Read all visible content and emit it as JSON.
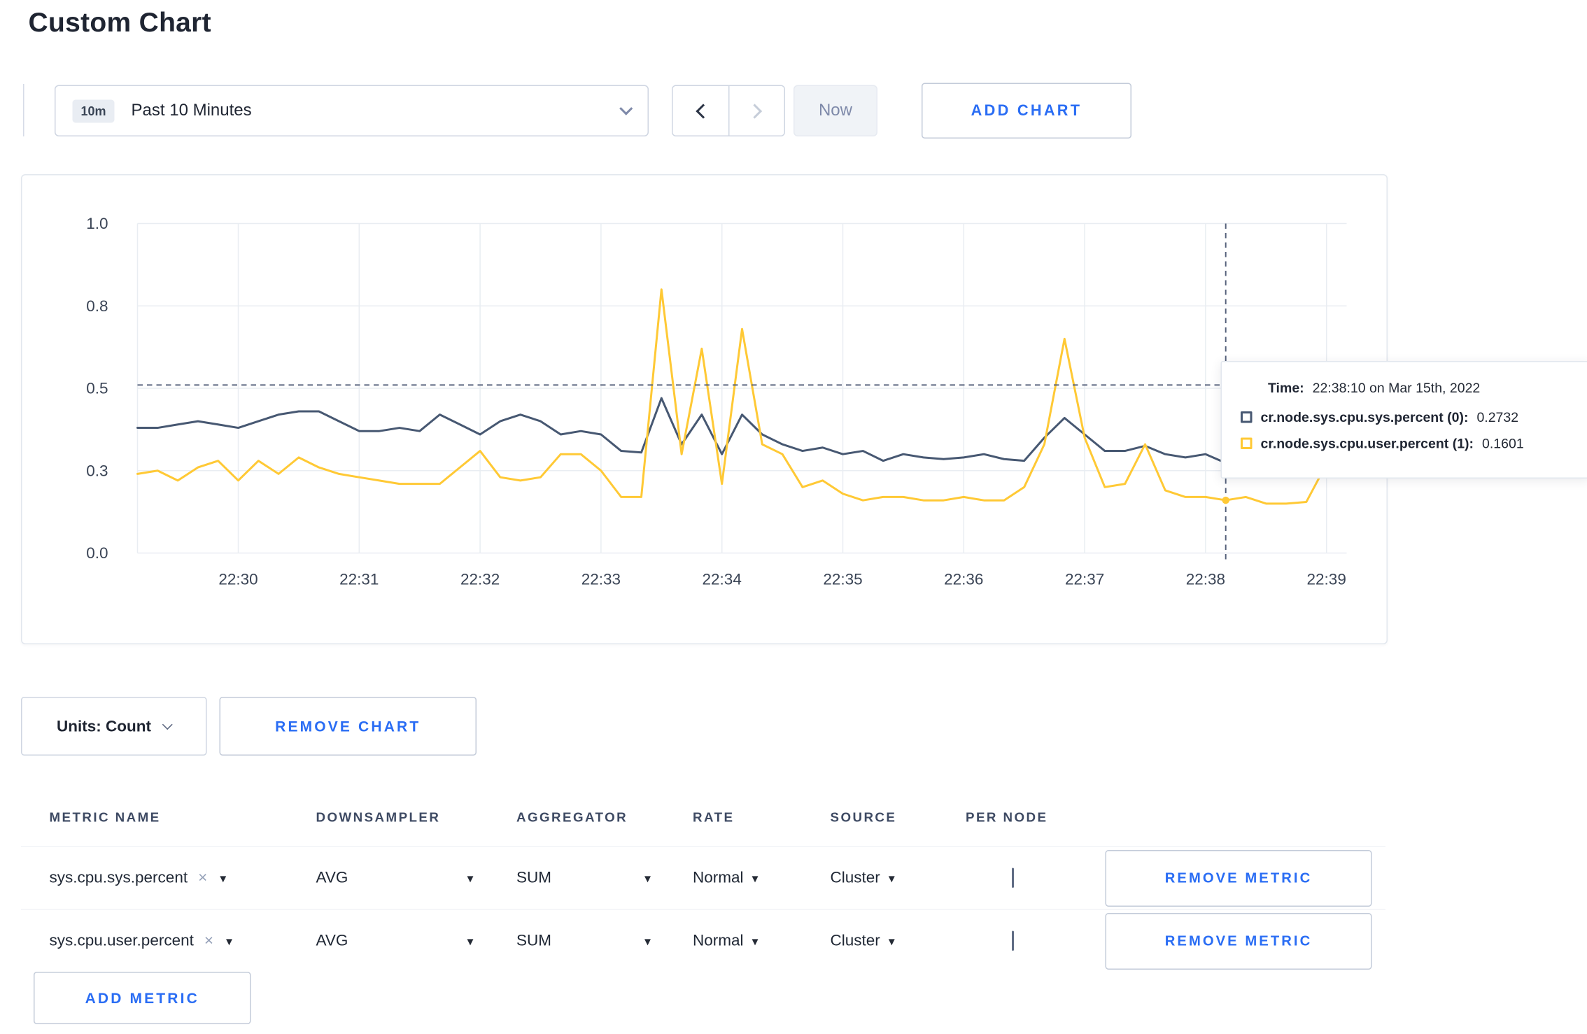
{
  "page": {
    "title": "Custom Chart"
  },
  "toolbar": {
    "range_badge": "10m",
    "range_label": "Past 10 Minutes",
    "prev_icon": "chevron-left",
    "next_icon": "chevron-right",
    "now_label": "Now",
    "add_chart_label": "ADD CHART"
  },
  "tooltip": {
    "time_label": "Time:",
    "time_value": "22:38:10 on Mar 15th, 2022",
    "series": [
      {
        "name": "cr.node.sys.cpu.sys.percent (0):",
        "value": "0.2732",
        "color": "#475872"
      },
      {
        "name": "cr.node.sys.cpu.user.percent (1):",
        "value": "0.1601",
        "color": "#ffc935"
      }
    ]
  },
  "chart_data": {
    "type": "line",
    "title": "",
    "x_start": "22:29:10",
    "x_step_seconds": 10,
    "x_domain_seconds": 600,
    "x_first_tick_offset_seconds": 50,
    "x_tick_labels": [
      "22:30",
      "22:31",
      "22:32",
      "22:33",
      "22:34",
      "22:35",
      "22:36",
      "22:37",
      "22:38",
      "22:39"
    ],
    "y_tick_values": [
      0,
      0.25,
      0.5,
      0.75,
      1.0
    ],
    "y_tick_labels": [
      "0.0",
      "0.3",
      "0.5",
      "0.8",
      "1.0"
    ],
    "ylim": [
      0,
      1
    ],
    "grid": true,
    "series": [
      {
        "name": "cr.node.sys.cpu.sys.percent",
        "color": "#475872",
        "values": [
          0.38,
          0.38,
          0.39,
          0.4,
          0.39,
          0.38,
          0.4,
          0.42,
          0.43,
          0.43,
          0.4,
          0.37,
          0.37,
          0.38,
          0.37,
          0.42,
          0.39,
          0.36,
          0.4,
          0.42,
          0.4,
          0.36,
          0.37,
          0.36,
          0.31,
          0.305,
          0.47,
          0.33,
          0.42,
          0.3,
          0.42,
          0.36,
          0.33,
          0.31,
          0.32,
          0.3,
          0.31,
          0.28,
          0.3,
          0.29,
          0.285,
          0.29,
          0.3,
          0.285,
          0.28,
          0.35,
          0.41,
          0.36,
          0.31,
          0.31,
          0.325,
          0.3,
          0.29,
          0.3,
          0.2732
        ]
      },
      {
        "name": "cr.node.sys.cpu.user.percent",
        "color": "#ffc935",
        "values": [
          0.24,
          0.25,
          0.22,
          0.26,
          0.28,
          0.22,
          0.28,
          0.24,
          0.29,
          0.26,
          0.24,
          0.23,
          0.22,
          0.21,
          0.21,
          0.21,
          0.26,
          0.31,
          0.23,
          0.22,
          0.23,
          0.3,
          0.3,
          0.25,
          0.17,
          0.17,
          0.8,
          0.3,
          0.62,
          0.21,
          0.68,
          0.33,
          0.3,
          0.2,
          0.22,
          0.18,
          0.16,
          0.17,
          0.17,
          0.16,
          0.16,
          0.17,
          0.16,
          0.16,
          0.2,
          0.33,
          0.65,
          0.35,
          0.2,
          0.21,
          0.33,
          0.19,
          0.17,
          0.17,
          0.1601,
          0.17,
          0.15,
          0.15,
          0.155,
          0.27,
          0.25
        ]
      }
    ],
    "crosshair": {
      "x_index": 54,
      "y_value": 0.51,
      "time_label": "22:38:10"
    }
  },
  "chart_controls": {
    "units_label": "Units: Count",
    "remove_chart_label": "REMOVE CHART"
  },
  "metrics_table": {
    "headers": [
      "METRIC NAME",
      "DOWNSAMPLER",
      "AGGREGATOR",
      "RATE",
      "SOURCE",
      "PER NODE"
    ],
    "rows": [
      {
        "metric": "sys.cpu.sys.percent",
        "downsampler": "AVG",
        "aggregator": "SUM",
        "rate": "Normal",
        "source": "Cluster",
        "per_node_checked": false,
        "remove_label": "REMOVE METRIC"
      },
      {
        "metric": "sys.cpu.user.percent",
        "downsampler": "AVG",
        "aggregator": "SUM",
        "rate": "Normal",
        "source": "Cluster",
        "per_node_checked": false,
        "remove_label": "REMOVE METRIC"
      }
    ],
    "add_metric_label": "ADD METRIC"
  }
}
